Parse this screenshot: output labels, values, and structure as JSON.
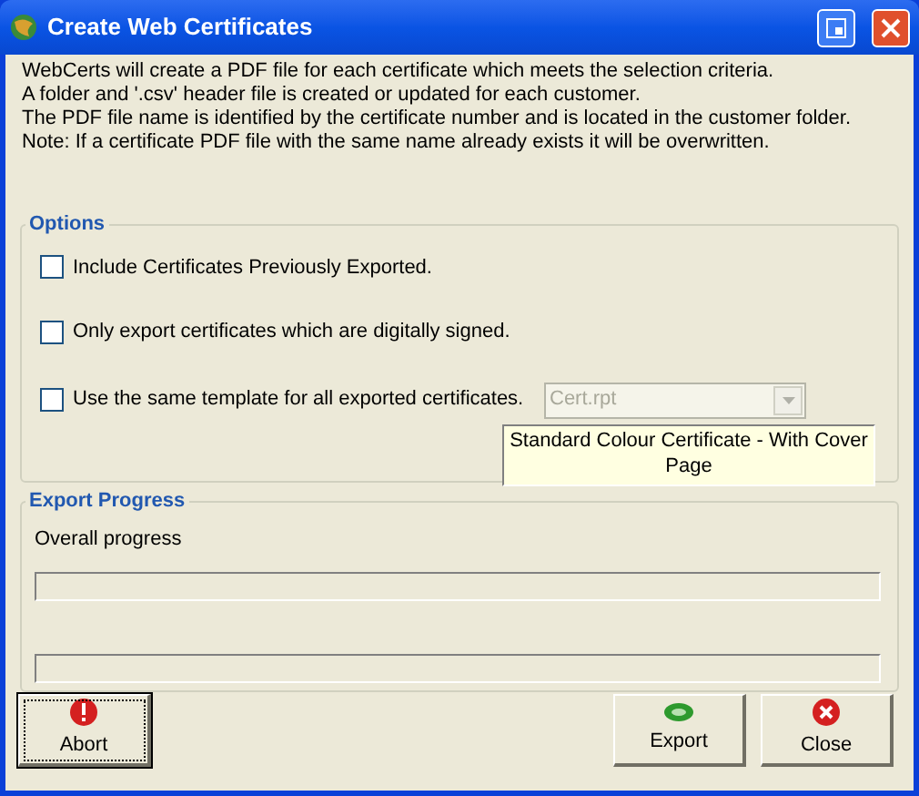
{
  "window": {
    "title": "Create Web Certificates"
  },
  "intro": [
    "WebCerts will create a PDF file for each certificate which meets the selection criteria.",
    "A folder and '.csv' header file is created or updated for each customer.",
    "The PDF file name is identified by the certificate number and is located in the customer folder.",
    "Note: If a certificate PDF file with the same name already exists it will be overwritten."
  ],
  "options": {
    "title": "Options",
    "checkboxes": [
      {
        "label": "Include Certificates Previously Exported.",
        "checked": false
      },
      {
        "label": "Only export certificates which are digitally signed.",
        "checked": false
      },
      {
        "label": "Use the same template for all exported certificates.",
        "checked": false
      }
    ],
    "template": {
      "value": "Cert.rpt",
      "disabled": true
    },
    "template_description": "Standard Colour Certificate - With Cover Page"
  },
  "export_progress": {
    "title": "Export Progress",
    "label": "Overall progress",
    "bars": [
      {
        "level": 0
      },
      {
        "level": 0
      }
    ]
  },
  "buttons": [
    {
      "label": "Abort",
      "kind": "abort",
      "focused": true
    },
    {
      "label": "Export",
      "kind": "export",
      "focused": false
    },
    {
      "label": "Close",
      "kind": "close",
      "focused": false
    }
  ]
}
